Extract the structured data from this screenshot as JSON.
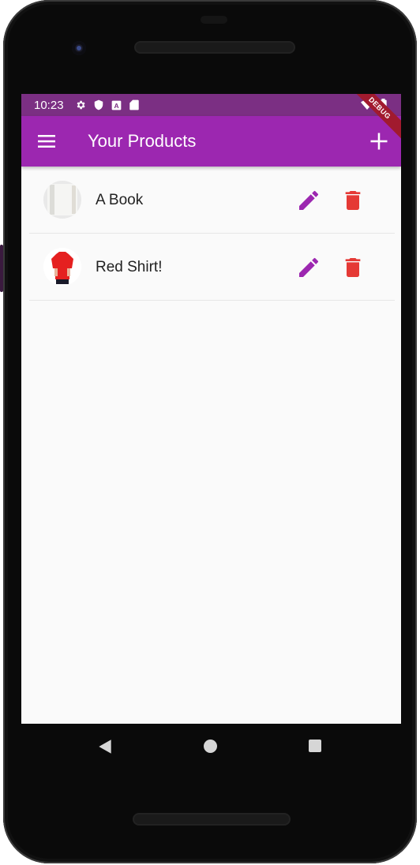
{
  "status_bar": {
    "time": "10:23",
    "icons": [
      "gear-icon",
      "shield-icon",
      "a-letter-icon",
      "sd-card-icon",
      "wifi-icon",
      "battery-icon"
    ]
  },
  "debug_banner": "DEBUG",
  "app_bar": {
    "title": "Your Products",
    "menu_icon": "menu-icon",
    "add_icon": "add-icon"
  },
  "products": [
    {
      "title": "A Book",
      "image": "book-image"
    },
    {
      "title": "Red Shirt!",
      "image": "red-shirt-image"
    }
  ],
  "colors": {
    "primary": "#9c27b0",
    "status_bar": "#7b2f83",
    "edit": "#9c27b0",
    "delete": "#e53935",
    "background": "#fafafa"
  },
  "nav_bar": {
    "icons": [
      "back-icon",
      "home-icon",
      "recents-icon"
    ]
  }
}
